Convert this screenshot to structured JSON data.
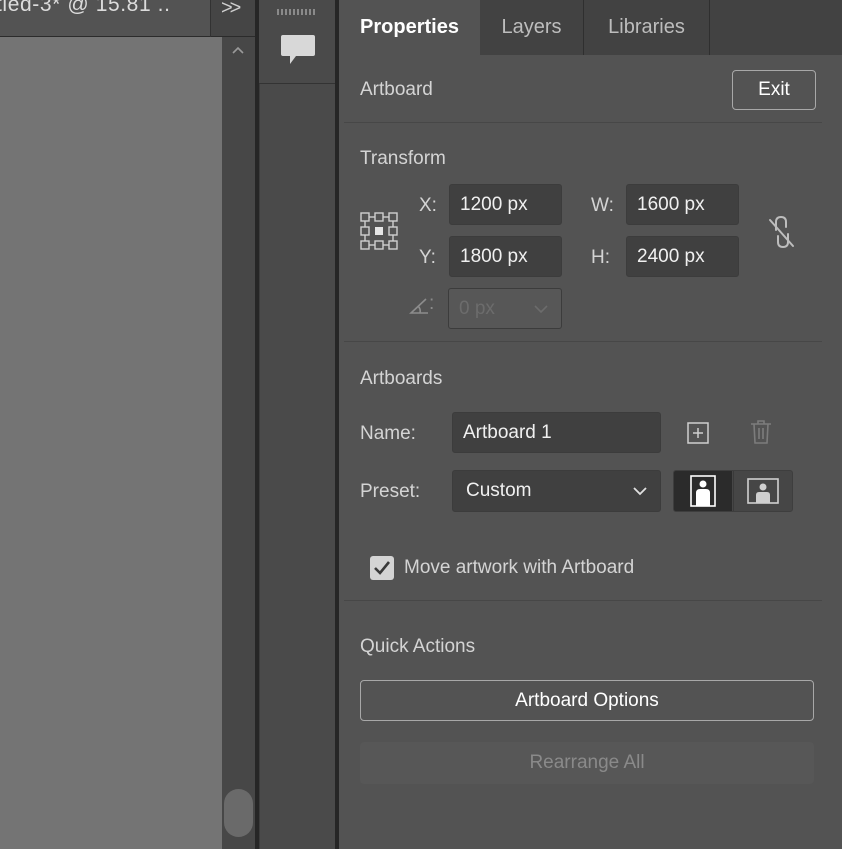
{
  "document": {
    "tab_title": "tled-3* @ 15.81 ..",
    "tab_overflow_glyph": ">>"
  },
  "panel": {
    "tabs": [
      {
        "label": "Properties",
        "active": true
      },
      {
        "label": "Layers",
        "active": false
      },
      {
        "label": "Libraries",
        "active": false
      }
    ],
    "artboard_section": {
      "title": "Artboard",
      "exit_label": "Exit"
    },
    "transform": {
      "title": "Transform",
      "x_label": "X:",
      "x_value": "1200 px",
      "y_label": "Y:",
      "y_value": "1800 px",
      "w_label": "W:",
      "w_value": "1600 px",
      "h_label": "H:",
      "h_value": "2400 px",
      "angle_label": ":",
      "angle_value": "0 px"
    },
    "artboards": {
      "title": "Artboards",
      "name_label": "Name:",
      "name_value": "Artboard 1",
      "preset_label": "Preset:",
      "preset_value": "Custom",
      "move_artwork_label": "Move artwork with Artboard",
      "move_artwork_checked": true
    },
    "quick_actions": {
      "title": "Quick Actions",
      "artboard_options_label": "Artboard Options",
      "rearrange_all_label": "Rearrange All"
    }
  },
  "colors": {
    "panel_bg": "#535353",
    "tabbar_bg": "#424242",
    "field_bg": "#404040",
    "canvas_bg": "#747474"
  }
}
